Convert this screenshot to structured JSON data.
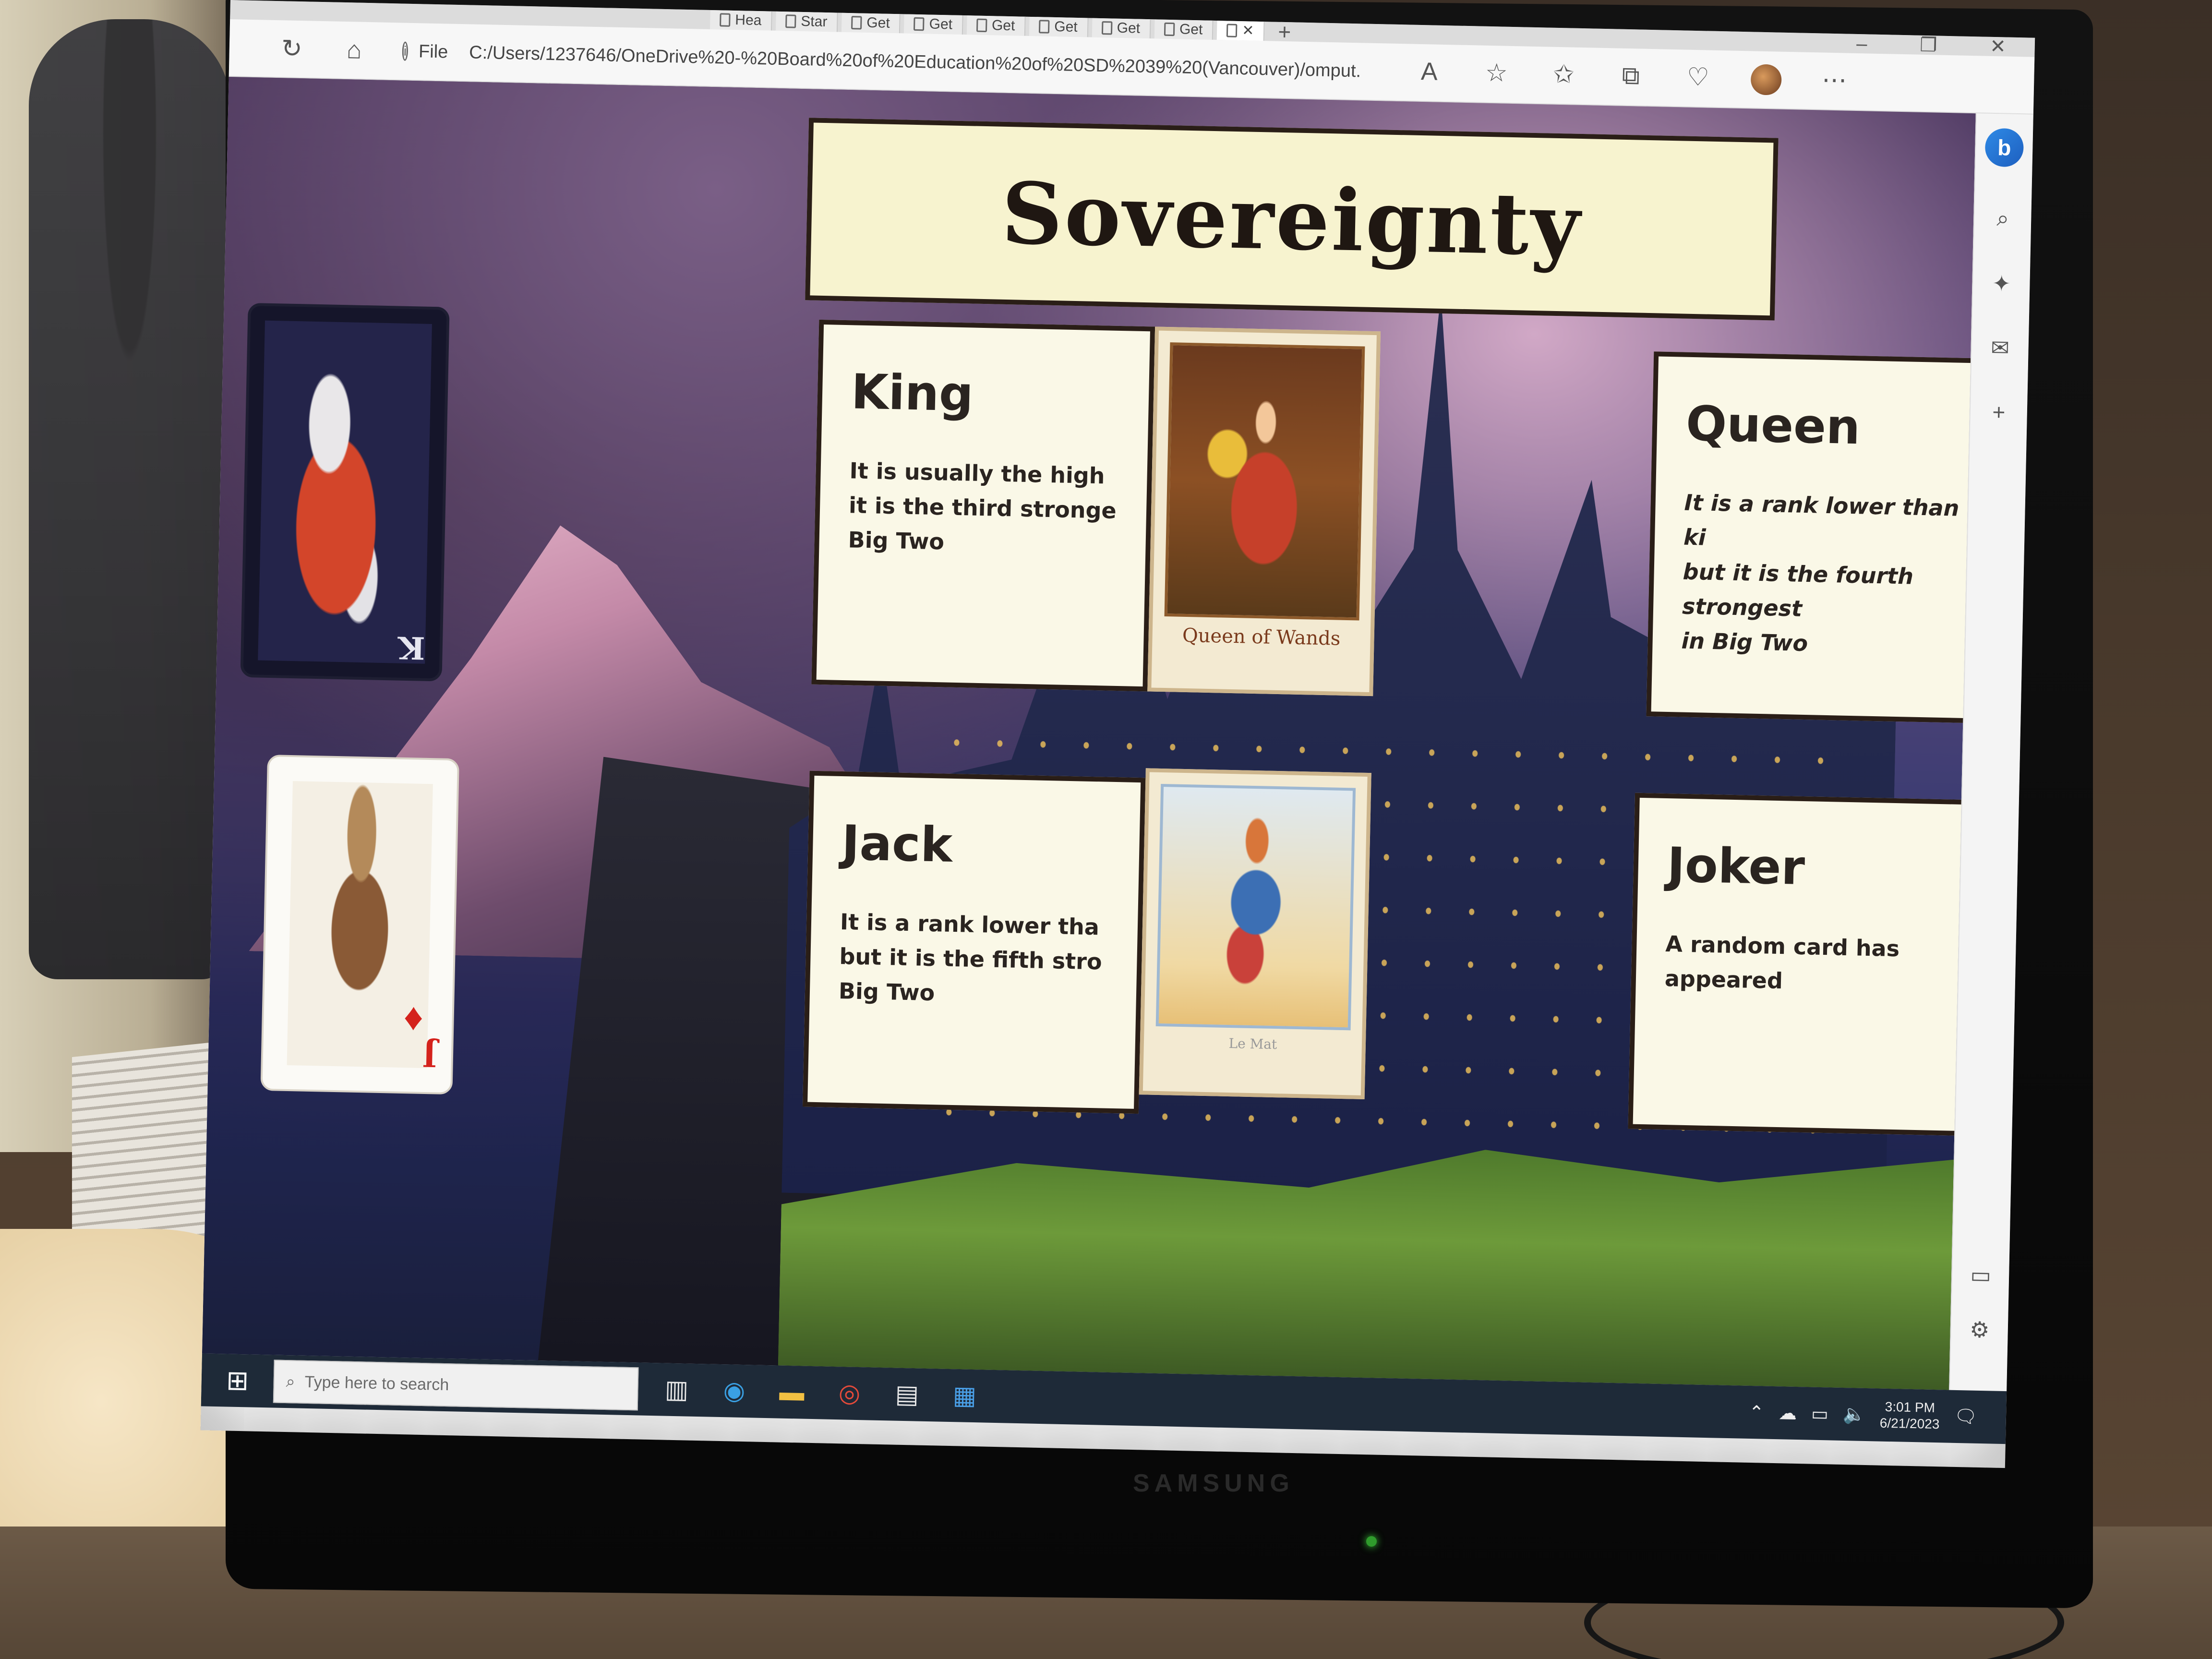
{
  "browser": {
    "tabs": [
      {
        "label": "Hea"
      },
      {
        "label": "Star"
      },
      {
        "label": "Get"
      },
      {
        "label": "Get"
      },
      {
        "label": "Get"
      },
      {
        "label": "Get"
      },
      {
        "label": "Get"
      },
      {
        "label": "Get"
      },
      {
        "label": ""
      }
    ],
    "address_prefix": "File",
    "url": "C:/Users/1237646/OneDrive%20-%20Board%20of%20Education%20of%20SD%2039%20(Vancouver)/omput..."
  },
  "page": {
    "title": "Sovereignty",
    "cards": {
      "king": {
        "title": "King",
        "desc": "It is usually the high\nit is the third stronge\nBig Two"
      },
      "queen": {
        "title": "Queen",
        "desc": "It is a rank lower than the ki\nbut it is the fourth strongest\nin Big Two"
      },
      "jack": {
        "title": "Jack",
        "desc": "It is a rank lower tha\nbut it is the fifth stro\nBig Two"
      },
      "joker": {
        "title": "Joker",
        "desc": "A random card has appeared"
      }
    },
    "tarot_king_caption": "Queen of Wands",
    "tarot_jack_caption": "Le Mat",
    "playing_card_king_rank": "K",
    "playing_card_jack_rank": "J"
  },
  "taskbar": {
    "search_placeholder": "Type here to search",
    "time": "3:01 PM",
    "date": "6/21/2023"
  },
  "monitor": {
    "brand": "SAMSUNG"
  }
}
